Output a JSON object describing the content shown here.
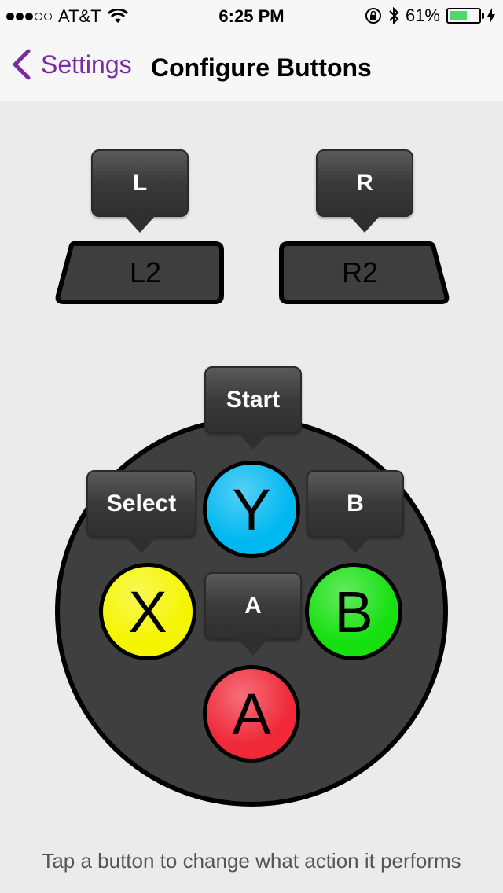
{
  "status_bar": {
    "carrier": "AT&T",
    "time": "6:25 PM",
    "battery_percent": "61%",
    "battery_level": 0.61,
    "signal_bars_filled": 3,
    "signal_bars_total": 5
  },
  "nav": {
    "back_label": "Settings",
    "title": "Configure Buttons"
  },
  "shoulders": {
    "left": {
      "label": "L2",
      "mapping": "L"
    },
    "right": {
      "label": "R2",
      "mapping": "R"
    }
  },
  "face_buttons": {
    "y": {
      "label": "Y",
      "mapping": "Start",
      "color": "#00b8f0"
    },
    "x": {
      "label": "X",
      "mapping": "Select",
      "color": "#f5f500"
    },
    "b": {
      "label": "B",
      "mapping": "B",
      "color": "#16e010"
    },
    "a": {
      "label": "A",
      "mapping": "A",
      "color": "#f02838"
    }
  },
  "hint": "Tap a button to change what action it performs",
  "colors": {
    "accent": "#7b2aa3"
  }
}
